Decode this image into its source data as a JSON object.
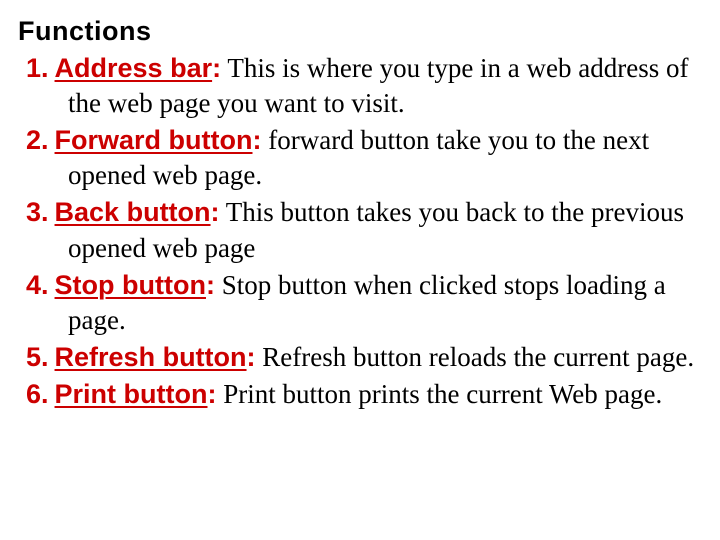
{
  "heading": "Functions",
  "items": [
    {
      "num": "1.",
      "term": "Address bar",
      "desc": " This is where you type in a web address of the web page you want to visit."
    },
    {
      "num": "2.",
      "term": "Forward button",
      "desc": " forward button take you to the next opened web page."
    },
    {
      "num": "3.",
      "term": "Back button",
      "desc": " This button takes you back to the previous opened web page"
    },
    {
      "num": "4.",
      "term": "Stop button",
      "desc": " Stop button when clicked stops loading a page."
    },
    {
      "num": "5.",
      "term": "Refresh button",
      "desc": " Refresh button reloads the current page."
    },
    {
      "num": "6.",
      "term": "Print button",
      "desc": " Print button prints the current Web page."
    }
  ]
}
